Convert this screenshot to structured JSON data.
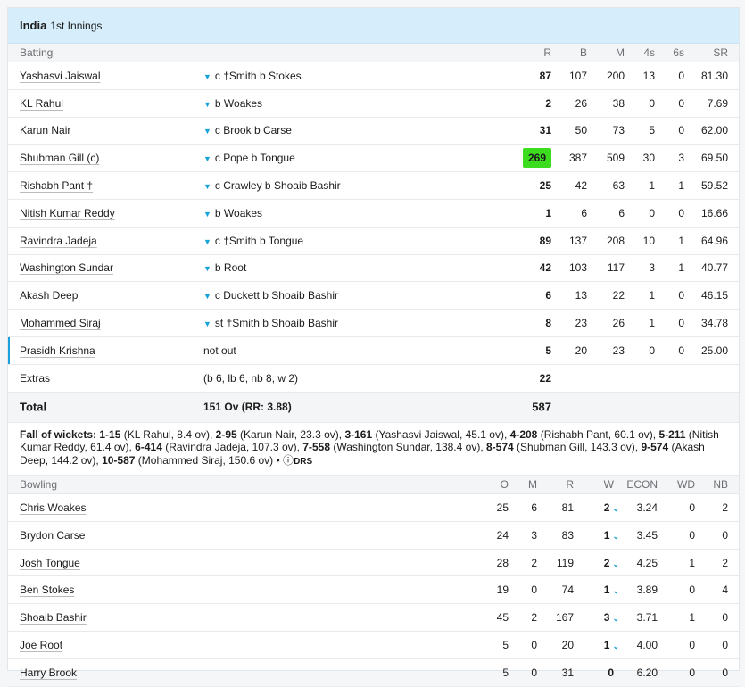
{
  "header": {
    "team": "India",
    "innings": "1st Innings"
  },
  "batting": {
    "headers": {
      "title": "Batting",
      "r": "R",
      "b": "B",
      "m": "M",
      "fours": "4s",
      "sixes": "6s",
      "sr": "SR"
    },
    "rows": [
      {
        "name": "Yashasvi Jaiswal",
        "dismissal": "c †Smith b Stokes",
        "r": "87",
        "b": "107",
        "m": "200",
        "fours": "13",
        "sixes": "0",
        "sr": "81.30"
      },
      {
        "name": "KL Rahul",
        "dismissal": "b Woakes",
        "r": "2",
        "b": "26",
        "m": "38",
        "fours": "0",
        "sixes": "0",
        "sr": "7.69"
      },
      {
        "name": "Karun Nair",
        "dismissal": "c Brook b Carse",
        "r": "31",
        "b": "50",
        "m": "73",
        "fours": "5",
        "sixes": "0",
        "sr": "62.00"
      },
      {
        "name": "Shubman Gill (c)",
        "dismissal": "c Pope b Tongue",
        "r": "269",
        "b": "387",
        "m": "509",
        "fours": "30",
        "sixes": "3",
        "sr": "69.50"
      },
      {
        "name": "Rishabh Pant †",
        "dismissal": "c Crawley b Shoaib Bashir",
        "r": "25",
        "b": "42",
        "m": "63",
        "fours": "1",
        "sixes": "1",
        "sr": "59.52"
      },
      {
        "name": "Nitish Kumar Reddy",
        "dismissal": "b Woakes",
        "r": "1",
        "b": "6",
        "m": "6",
        "fours": "0",
        "sixes": "0",
        "sr": "16.66"
      },
      {
        "name": "Ravindra Jadeja",
        "dismissal": "c †Smith b Tongue",
        "r": "89",
        "b": "137",
        "m": "208",
        "fours": "10",
        "sixes": "1",
        "sr": "64.96"
      },
      {
        "name": "Washington Sundar",
        "dismissal": "b Root",
        "r": "42",
        "b": "103",
        "m": "117",
        "fours": "3",
        "sixes": "1",
        "sr": "40.77"
      },
      {
        "name": "Akash Deep",
        "dismissal": "c Duckett b Shoaib Bashir",
        "r": "6",
        "b": "13",
        "m": "22",
        "fours": "1",
        "sixes": "0",
        "sr": "46.15"
      },
      {
        "name": "Mohammed Siraj",
        "dismissal": "st †Smith b Shoaib Bashir",
        "r": "8",
        "b": "23",
        "m": "26",
        "fours": "1",
        "sixes": "0",
        "sr": "34.78"
      },
      {
        "name": "Prasidh Krishna",
        "dismissal": "not out",
        "r": "5",
        "b": "20",
        "m": "23",
        "fours": "0",
        "sixes": "0",
        "sr": "25.00"
      }
    ],
    "extras": {
      "label": "Extras",
      "detail": "(b 6, lb 6, nb 8, w 2)",
      "value": "22"
    },
    "total": {
      "label": "Total",
      "detail": "151 Ov (RR: 3.88)",
      "value": "587"
    }
  },
  "fall_of_wickets": {
    "label": "Fall of wickets:",
    "items": [
      {
        "score": "1-15",
        "detail": "(KL Rahul, 8.4 ov)"
      },
      {
        "score": "2-95",
        "detail": "(Karun Nair, 23.3 ov)"
      },
      {
        "score": "3-161",
        "detail": "(Yashasvi Jaiswal, 45.1 ov)"
      },
      {
        "score": "4-208",
        "detail": "(Rishabh Pant, 60.1 ov)"
      },
      {
        "score": "5-211",
        "detail": "(Nitish Kumar Reddy, 61.4 ov)"
      },
      {
        "score": "6-414",
        "detail": "(Ravindra Jadeja, 107.3 ov)"
      },
      {
        "score": "7-558",
        "detail": "(Washington Sundar, 138.4 ov)"
      },
      {
        "score": "8-574",
        "detail": "(Shubman Gill, 143.3 ov)"
      },
      {
        "score": "9-574",
        "detail": "(Akash Deep, 144.2 ov)"
      },
      {
        "score": "10-587",
        "detail": "(Mohammed Siraj, 150.6 ov)"
      }
    ],
    "drs_label": "DRS"
  },
  "bowling": {
    "headers": {
      "title": "Bowling",
      "o": "O",
      "m": "M",
      "r": "R",
      "w": "W",
      "econ": "ECON",
      "wd": "WD",
      "nb": "NB"
    },
    "rows": [
      {
        "name": "Chris Woakes",
        "o": "25",
        "m": "6",
        "r": "81",
        "w": "2",
        "econ": "3.24",
        "wd": "0",
        "nb": "2",
        "chev": true
      },
      {
        "name": "Brydon Carse",
        "o": "24",
        "m": "3",
        "r": "83",
        "w": "1",
        "econ": "3.45",
        "wd": "0",
        "nb": "0",
        "chev": true
      },
      {
        "name": "Josh Tongue",
        "o": "28",
        "m": "2",
        "r": "119",
        "w": "2",
        "econ": "4.25",
        "wd": "1",
        "nb": "2",
        "chev": true
      },
      {
        "name": "Ben Stokes",
        "o": "19",
        "m": "0",
        "r": "74",
        "w": "1",
        "econ": "3.89",
        "wd": "0",
        "nb": "4",
        "chev": true
      },
      {
        "name": "Shoaib Bashir",
        "o": "45",
        "m": "2",
        "r": "167",
        "w": "3",
        "econ": "3.71",
        "wd": "1",
        "nb": "0",
        "chev": true
      },
      {
        "name": "Joe Root",
        "o": "5",
        "m": "0",
        "r": "20",
        "w": "1",
        "econ": "4.00",
        "wd": "0",
        "nb": "0",
        "chev": true
      },
      {
        "name": "Harry Brook",
        "o": "5",
        "m": "0",
        "r": "31",
        "w": "0",
        "econ": "6.20",
        "wd": "0",
        "nb": "0",
        "chev": false
      }
    ]
  },
  "colors": {
    "header_bg": "#d6eefb",
    "highlight": "#3cdc1f",
    "accent": "#1aa0dc"
  }
}
